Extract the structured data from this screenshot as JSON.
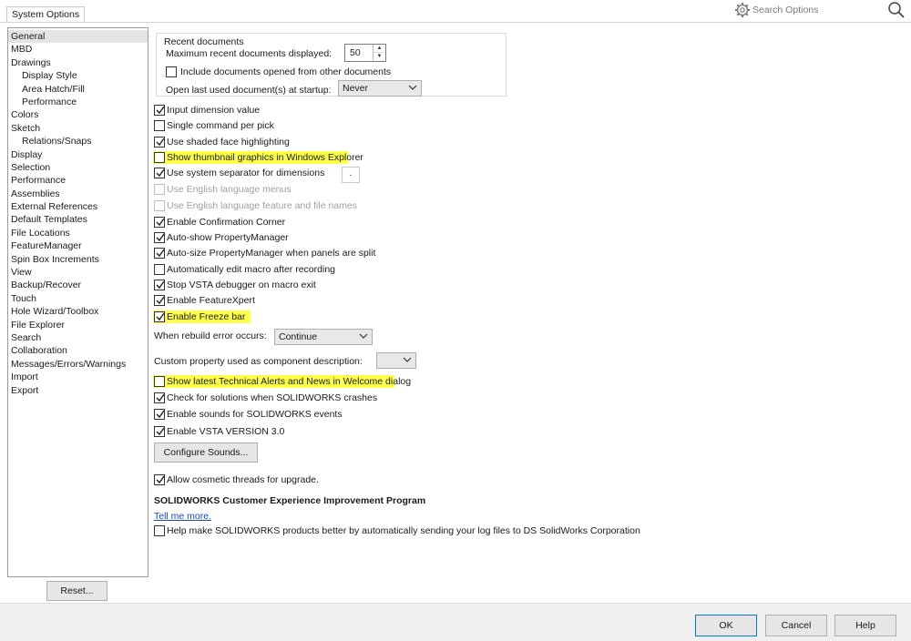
{
  "window": {
    "title": "System Options"
  },
  "search": {
    "placeholder": "Search Options"
  },
  "tree": {
    "items": [
      {
        "label": "General",
        "sub": false,
        "selected": true
      },
      {
        "label": "MBD",
        "sub": false
      },
      {
        "label": "Drawings",
        "sub": false
      },
      {
        "label": "Display Style",
        "sub": true
      },
      {
        "label": "Area Hatch/Fill",
        "sub": true
      },
      {
        "label": "Performance",
        "sub": true
      },
      {
        "label": "Colors",
        "sub": false
      },
      {
        "label": "Sketch",
        "sub": false
      },
      {
        "label": "Relations/Snaps",
        "sub": true
      },
      {
        "label": "Display",
        "sub": false
      },
      {
        "label": "Selection",
        "sub": false
      },
      {
        "label": "Performance",
        "sub": false
      },
      {
        "label": "Assemblies",
        "sub": false
      },
      {
        "label": "External References",
        "sub": false
      },
      {
        "label": "Default Templates",
        "sub": false
      },
      {
        "label": "File Locations",
        "sub": false
      },
      {
        "label": "FeatureManager",
        "sub": false
      },
      {
        "label": "Spin Box Increments",
        "sub": false
      },
      {
        "label": "View",
        "sub": false
      },
      {
        "label": "Backup/Recover",
        "sub": false
      },
      {
        "label": "Touch",
        "sub": false
      },
      {
        "label": "Hole Wizard/Toolbox",
        "sub": false
      },
      {
        "label": "File Explorer",
        "sub": false
      },
      {
        "label": "Search",
        "sub": false
      },
      {
        "label": "Collaboration",
        "sub": false
      },
      {
        "label": "Messages/Errors/Warnings",
        "sub": false
      },
      {
        "label": "Import",
        "sub": false
      },
      {
        "label": "Export",
        "sub": false
      }
    ]
  },
  "reset": {
    "label": "Reset..."
  },
  "recent": {
    "title": "Recent documents",
    "max_label": "Maximum recent documents displayed:",
    "max_value": "50",
    "include_label": "Include documents opened from other documents",
    "include_checked": false,
    "open_last_label": "Open last used document(s) at startup:",
    "open_last_value": "Never"
  },
  "options": {
    "input_dimension": {
      "label": "Input dimension value",
      "checked": true
    },
    "single_command": {
      "label": "Single command per pick",
      "checked": false
    },
    "shaded_face": {
      "label": "Use shaded face highlighting",
      "checked": true
    },
    "thumbnail": {
      "label": "Show thumbnail graphics in Windows Explorer",
      "checked": false
    },
    "system_separator": {
      "label": "Use system separator for dimensions",
      "checked": true,
      "separator_value": "."
    },
    "english_menus": {
      "label": "Use English language menus",
      "checked": false
    },
    "english_features": {
      "label": "Use English language feature and file names",
      "checked": false
    },
    "confirmation_corner": {
      "label": "Enable Confirmation Corner",
      "checked": true
    },
    "auto_show_pm": {
      "label": "Auto-show PropertyManager",
      "checked": true
    },
    "auto_size_pm": {
      "label": "Auto-size PropertyManager when panels are split",
      "checked": true
    },
    "auto_edit_macro": {
      "label": "Automatically edit macro after recording",
      "checked": false
    },
    "stop_vsta": {
      "label": "Stop VSTA debugger on macro exit",
      "checked": true
    },
    "featurexpert": {
      "label": "Enable FeatureXpert",
      "checked": true
    },
    "freeze_bar": {
      "label": "Enable Freeze bar",
      "checked": true
    },
    "rebuild_error_label": "When rebuild error occurs:",
    "rebuild_error_value": "Continue",
    "custom_property_label": "Custom property used as component description:",
    "custom_property_value": "",
    "tech_alerts": {
      "label": "Show latest Technical Alerts and News in Welcome dialog",
      "checked": false
    },
    "check_solutions": {
      "label": "Check for solutions when SOLIDWORKS crashes",
      "checked": true
    },
    "enable_sounds": {
      "label": "Enable sounds for SOLIDWORKS events",
      "checked": true
    },
    "vsta_version": {
      "label": "Enable VSTA VERSION 3.0",
      "checked": true
    },
    "configure_sounds": "Configure Sounds...",
    "cosmetic_threads": {
      "label": "Allow cosmetic threads for upgrade.",
      "checked": true
    },
    "ceip_title": "SOLIDWORKS Customer Experience Improvement Program",
    "tell_me_more": "Tell me more.",
    "help_improve": {
      "label": "Help make SOLIDWORKS products better by automatically sending your log files to DS SolidWorks Corporation",
      "checked": false
    }
  },
  "footer": {
    "ok": "OK",
    "cancel": "Cancel",
    "help": "Help"
  },
  "colors": {
    "highlight": "#ffff4a",
    "ok_border": "#0078d7",
    "link": "#1a45c8"
  },
  "icons": [
    "gear-icon",
    "search-icon",
    "checkmark-icon",
    "chevron-down-icon",
    "spin-up-icon",
    "spin-down-icon"
  ]
}
